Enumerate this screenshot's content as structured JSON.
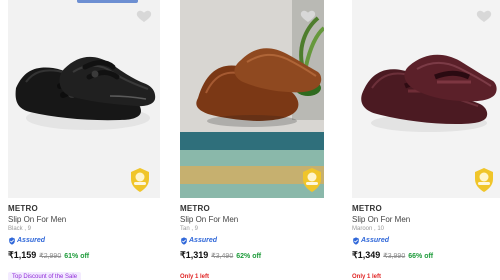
{
  "products": [
    {
      "brand": "METRO",
      "title": "Slip On For Men",
      "meta": "Black , 9",
      "assured_label": "Assured",
      "price": "₹1,159",
      "mrp": "₹2,990",
      "discount": "61% off",
      "footer_note": "Top Discount of the Sale",
      "footer_style": "chip"
    },
    {
      "brand": "METRO",
      "title": "Slip On For Men",
      "meta": "Tan , 9",
      "assured_label": "Assured",
      "price": "₹1,319",
      "mrp": "₹3,490",
      "discount": "62% off",
      "footer_note": "Only 1 left",
      "footer_style": "warning"
    },
    {
      "brand": "METRO",
      "title": "Slip On For Men",
      "meta": "Maroon , 10",
      "assured_label": "Assured",
      "price": "₹1,349",
      "mrp": "₹3,990",
      "discount": "66% off",
      "footer_note": "Only 1 left",
      "footer_style": "warning"
    }
  ],
  "badge": {
    "label": "BRAND ASSURANCE",
    "color": "#f0c52a"
  },
  "colors": {
    "assured": "#2f67d9",
    "discount": "#1d9b3a",
    "warning": "#e02424",
    "chip_text": "#8f27d8",
    "chip_bg": "#f3ebff"
  }
}
